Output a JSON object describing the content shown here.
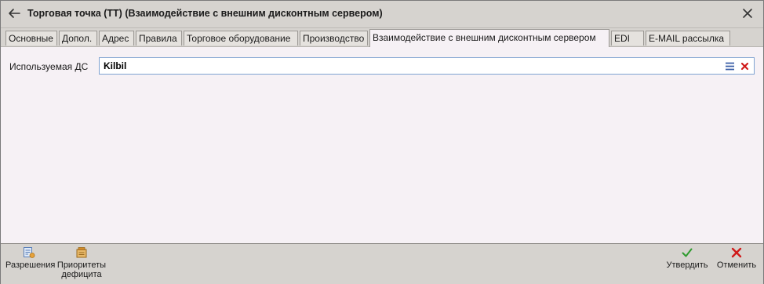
{
  "window": {
    "title": "Торговая точка (ТТ) (Взаимодействие с внешним дисконтным сервером)"
  },
  "tabs": [
    {
      "label": "Основные"
    },
    {
      "label": "Допол."
    },
    {
      "label": "Адрес"
    },
    {
      "label": "Правила"
    },
    {
      "label": "Торговое оборудование"
    },
    {
      "label": "Производство"
    },
    {
      "label": "Взаимодействие с внешним дисконтным сервером",
      "active": true
    },
    {
      "label": "EDI"
    },
    {
      "label": "E-MAIL рассылка"
    }
  ],
  "form": {
    "discount_server_label": "Используемая ДС",
    "discount_server_value": "Kilbil"
  },
  "footer": {
    "permissions_label": "Разрешения",
    "priorities_line1": "Приоритеты",
    "priorities_line2": "дефицита",
    "approve_label": "Утвердить",
    "cancel_label": "Отменить"
  },
  "colors": {
    "approve": "#2e9b2e",
    "cancel": "#d01a1a",
    "list_icon": "#3b5fa6"
  },
  "icons": {
    "back": "arrow-left-icon",
    "close": "close-icon",
    "list": "list-icon",
    "clear": "clear-icon",
    "permissions": "permissions-icon",
    "priorities": "priorities-icon",
    "approve": "checkmark-icon",
    "cancel": "cross-icon"
  }
}
